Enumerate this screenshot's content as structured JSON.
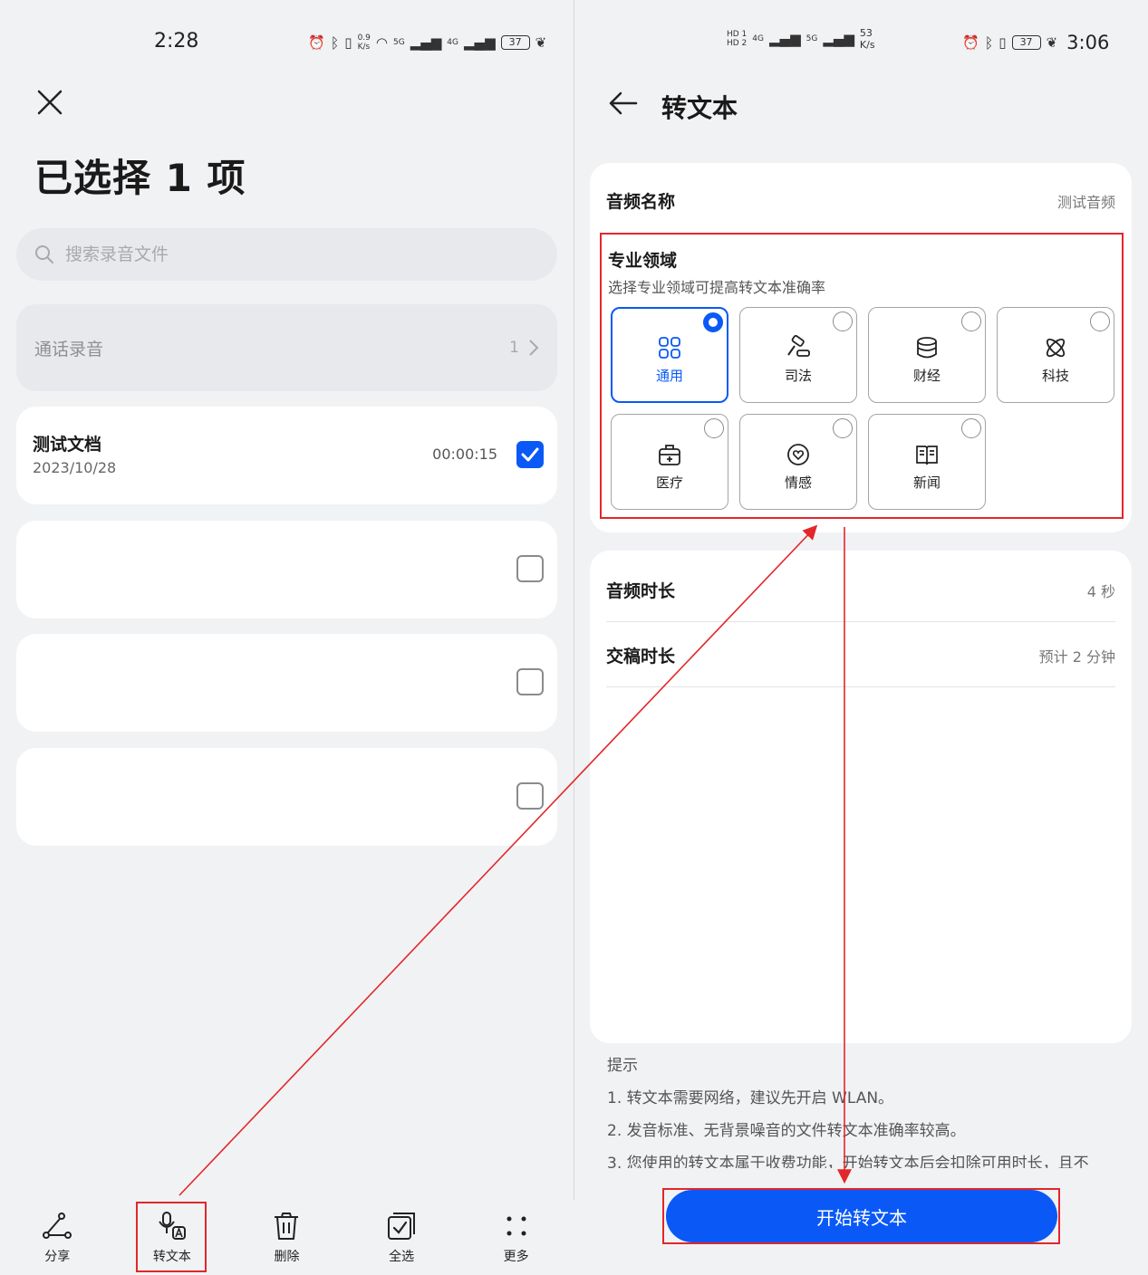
{
  "left": {
    "status_time": "2:28",
    "status_speed": "0.9\nK/s",
    "status_battery": "37",
    "status_net1": "5G",
    "status_net2": "4G",
    "title": "已选择 1 项",
    "search_placeholder": "搜索录音文件",
    "group": {
      "label": "通话录音",
      "count": "1"
    },
    "items": [
      {
        "title": "测试文档",
        "date": "2023/10/28",
        "duration": "00:00:15",
        "checked": true
      },
      {
        "title": "",
        "date": "",
        "duration": "",
        "checked": false
      },
      {
        "title": "",
        "date": "",
        "duration": "",
        "checked": false
      },
      {
        "title": "",
        "date": "",
        "duration": "",
        "checked": false
      }
    ],
    "toolbar": {
      "share": "分享",
      "transcribe": "转文本",
      "delete": "删除",
      "select_all": "全选",
      "more": "更多"
    }
  },
  "right": {
    "status_time": "3:06",
    "status_speed": "53",
    "status_speed_unit": "K/s",
    "status_battery": "37",
    "status_net1": "4G",
    "status_net2": "5G",
    "title": "转文本",
    "audio_name_label": "音频名称",
    "audio_name_value": "测试音频",
    "domain_title": "专业领域",
    "domain_subtitle": "选择专业领域可提高转文本准确率",
    "domains": [
      {
        "label": "通用",
        "icon": "grid-icon",
        "selected": true
      },
      {
        "label": "司法",
        "icon": "gavel-icon",
        "selected": false
      },
      {
        "label": "财经",
        "icon": "coins-icon",
        "selected": false
      },
      {
        "label": "科技",
        "icon": "atom-icon",
        "selected": false
      },
      {
        "label": "医疗",
        "icon": "medical-kit-icon",
        "selected": false
      },
      {
        "label": "情感",
        "icon": "heart-icon",
        "selected": false
      },
      {
        "label": "新闻",
        "icon": "book-icon",
        "selected": false
      }
    ],
    "duration_label": "音频时长",
    "duration_value": "4 秒",
    "delivery_label": "交稿时长",
    "delivery_value": "预计 2 分钟",
    "tips_title": "提示",
    "tips": [
      "1. 转文本需要网络，建议先开启 WLAN。",
      "2. 发音标准、无背景噪音的文件转文本准确率较高。",
      "3. 您使用的转文本属于收费功能，开始转文本后会扣除可用时长，且不"
    ],
    "start_button": "开始转文本"
  },
  "colors": {
    "accent": "#0a59f7",
    "highlight": "#e3262a",
    "background": "#f1f2f4"
  }
}
